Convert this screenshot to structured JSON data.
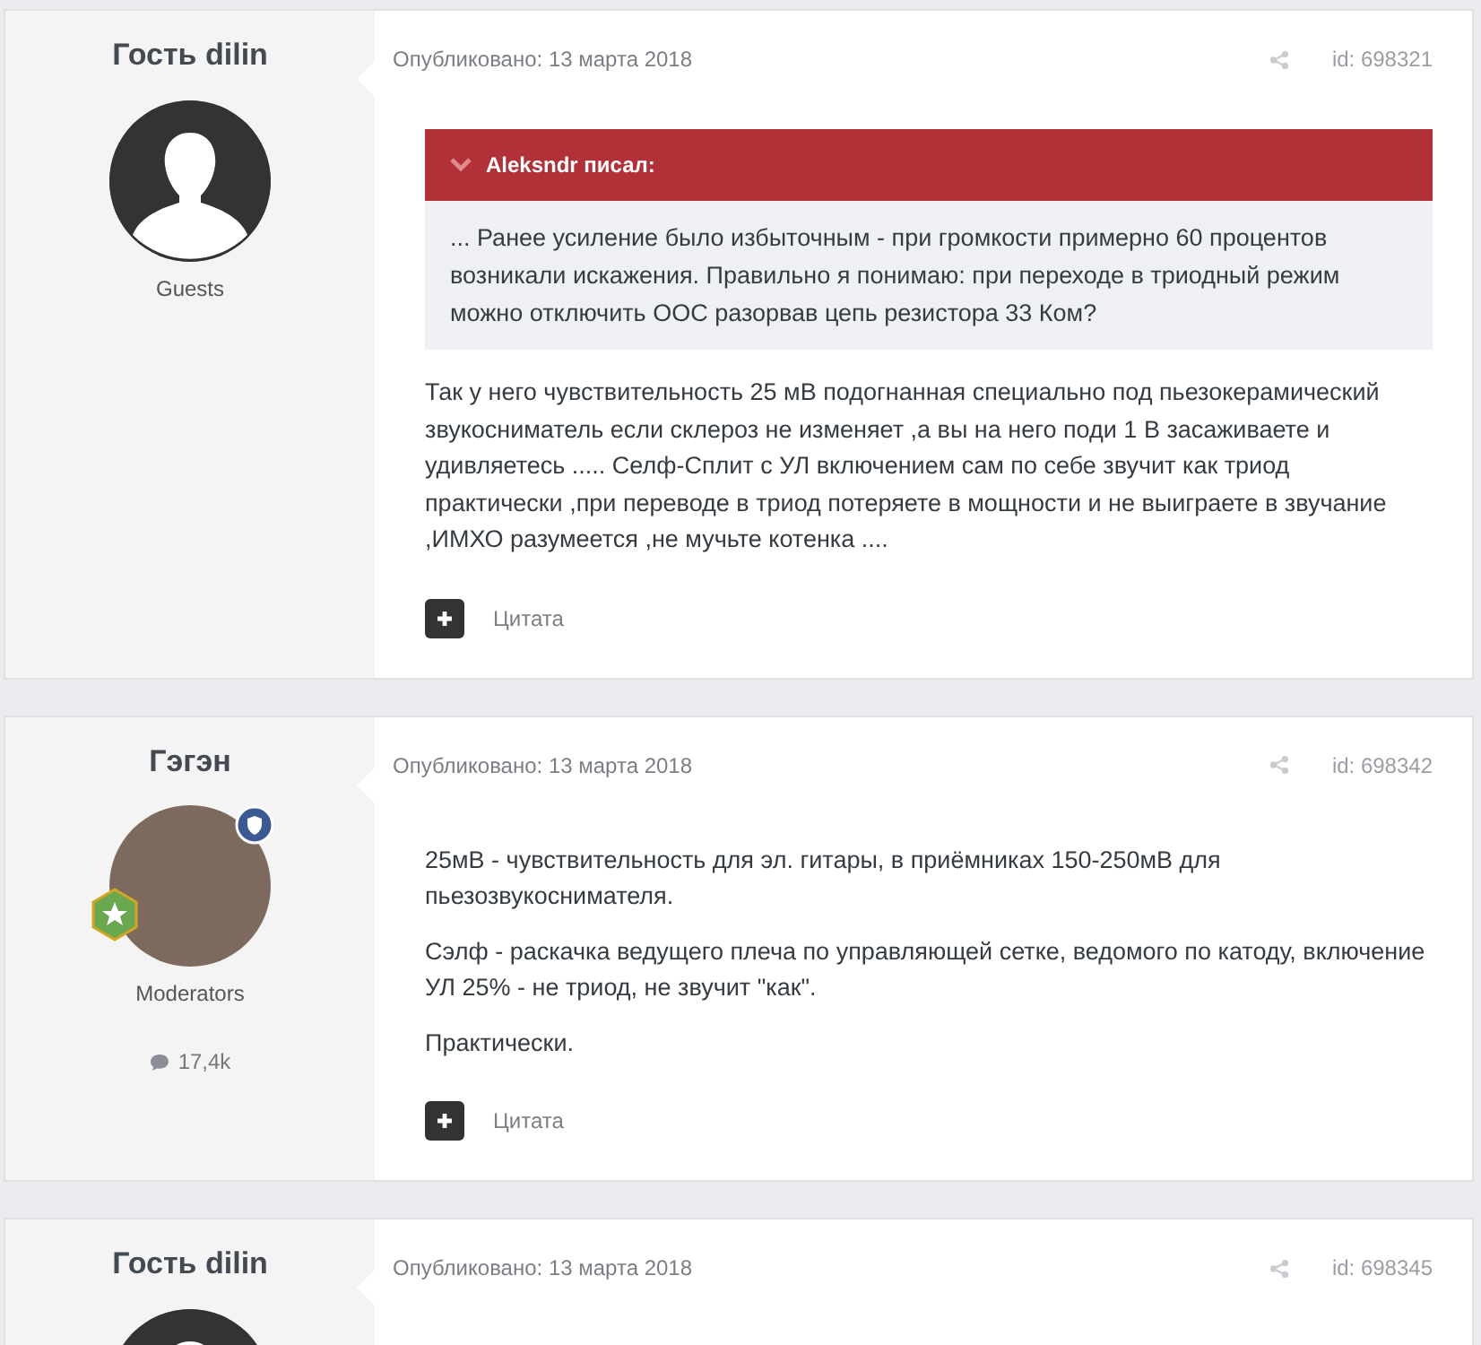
{
  "posts": [
    {
      "author": "Гость dilin",
      "kind": "silhouette",
      "moderator": false,
      "group": "Guests",
      "date": "Опубликовано: 13 марта 2018",
      "id": "id: 698321",
      "quote": {
        "author": "Aleksndr писал:",
        "text": "... Ранее усиление было избыточным - при громкости примерно 60 процентов возникали искажения. Правильно я понимаю: при переходе в триодный режим можно отключить ООС разорвав цепь резистора 33 Ком?"
      },
      "paragraphs": [
        "Так у него чувствительность 25 мВ подогнанная специально под пьезокерамический звукосниматель если склероз не изменяет ,а вы на него поди 1 В засаживаете и удивляетесь ..... Селф-Сплит с УЛ включением сам по себе звучит как триод практически ,при переводе в триод потеряете в мощности и не выиграете в звучание ,ИМХО разумеется ,не мучьте котенка ...."
      ],
      "quote_button": "Цитата"
    },
    {
      "author": "Гэгэн",
      "kind": "photo",
      "moderator": true,
      "group": "Moderators",
      "post_count": "17,4k",
      "date": "Опубликовано: 13 марта 2018",
      "id": "id: 698342",
      "paragraphs": [
        "25мВ - чувствительность для эл. гитары, в приёмниках 150-250мВ для пьезозвукоснимателя.",
        "Сэлф - раскачка ведущего плеча по управляющей сетке, ведомого по катоду, включение УЛ 25% - не триод, не звучит \"как\".",
        "Практически."
      ],
      "quote_button": "Цитата"
    },
    {
      "author": "Гость dilin",
      "kind": "silhouette",
      "moderator": false,
      "date": "Опубликовано: 13 марта 2018",
      "id": "id: 698345"
    }
  ]
}
